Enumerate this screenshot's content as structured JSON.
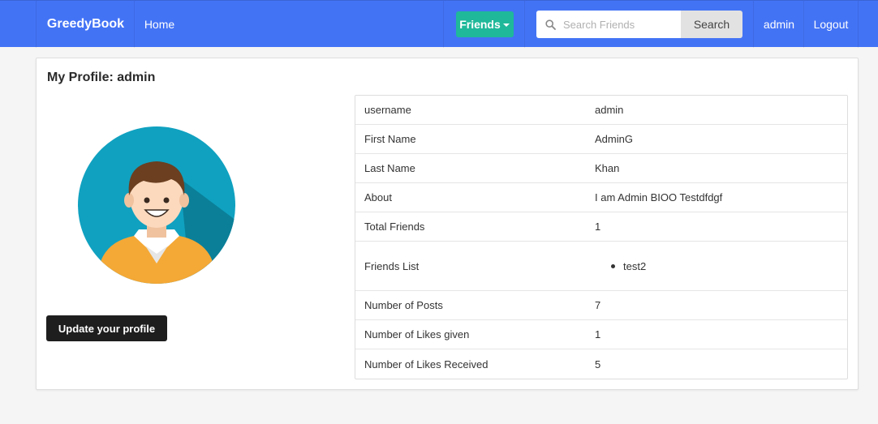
{
  "navbar": {
    "brand": "GreedyBook",
    "home": "Home",
    "friends": "Friends",
    "search_placeholder": "Search Friends",
    "search_button": "Search",
    "user": "admin",
    "logout": "Logout",
    "color": "#4373f5",
    "friends_color": "#1fb89a"
  },
  "profile": {
    "title": "My Profile: admin",
    "update_button": "Update your profile",
    "rows": [
      {
        "label": "username",
        "value": "admin"
      },
      {
        "label": "First Name",
        "value": "AdminG"
      },
      {
        "label": "Last Name",
        "value": "Khan"
      },
      {
        "label": "About",
        "value": "I am Admin BIOO Testdfdgf"
      },
      {
        "label": "Total Friends",
        "value": "1"
      },
      {
        "label": "Friends List",
        "friends": [
          "test2"
        ]
      },
      {
        "label": "Number of Posts",
        "value": "7"
      },
      {
        "label": "Number of Likes given",
        "value": "1"
      },
      {
        "label": "Number of Likes Received",
        "value": "5"
      }
    ]
  },
  "icons": {
    "search": "search-icon",
    "caret": "caret-down-icon",
    "avatar": "user-avatar"
  }
}
